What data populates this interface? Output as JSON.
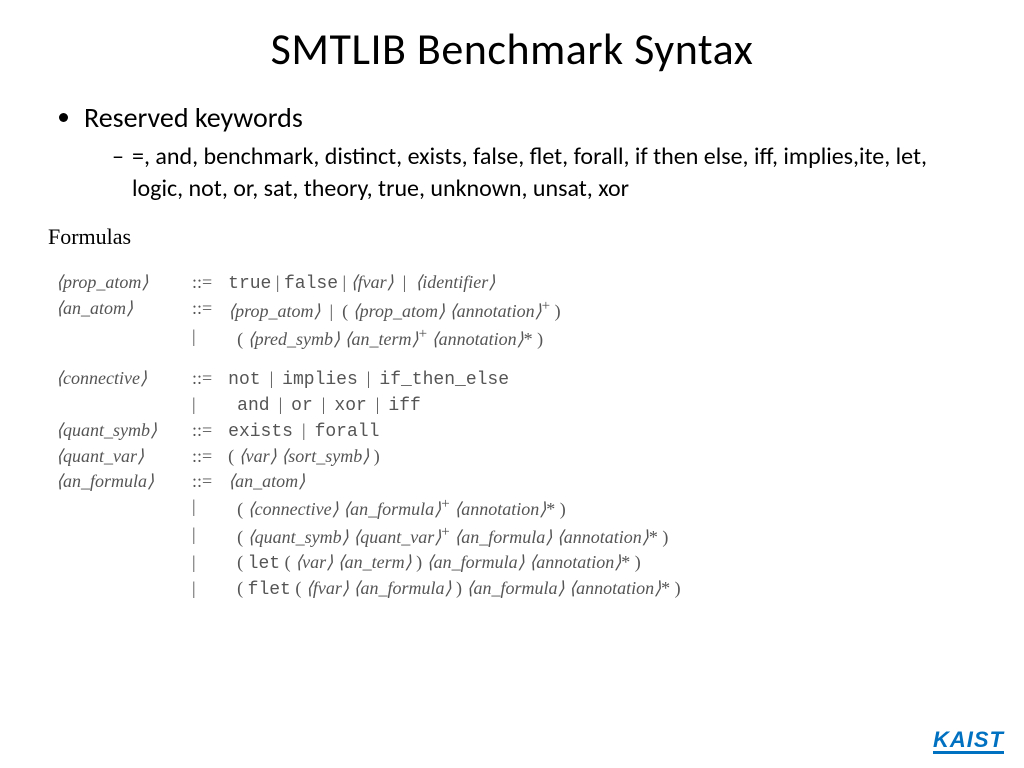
{
  "title": "SMTLIB Benchmark Syntax",
  "bullet1": "Reserved keywords",
  "bullet1_sub": "=, and, benchmark, distinct, exists, false, flet, forall, if then else, iff, implies,ite, let, logic, not, or, sat, theory, true, unknown, unsat, xor",
  "formulas_label": "Formulas",
  "grammar": {
    "prop_atom": {
      "lhs": "⟨prop_atom⟩",
      "rhs1": "true | false | ⟨fvar⟩ | ⟨identifier⟩"
    },
    "an_atom": {
      "lhs": "⟨an_atom⟩",
      "rhs1": "⟨prop_atom⟩ | ( ⟨prop_atom⟩ ⟨annotation⟩⁺ )",
      "rhs2": "( ⟨pred_symb⟩ ⟨an_term⟩⁺ ⟨annotation⟩* )"
    },
    "connective": {
      "lhs": "⟨connective⟩",
      "rhs1": "not | implies | if_then_else",
      "rhs2": "and | or | xor | iff"
    },
    "quant_symb": {
      "lhs": "⟨quant_symb⟩",
      "rhs1": "exists | forall"
    },
    "quant_var": {
      "lhs": "⟨quant_var⟩",
      "rhs1": "( ⟨var⟩ ⟨sort_symb⟩ )"
    },
    "an_formula": {
      "lhs": "⟨an_formula⟩",
      "rhs1": "⟨an_atom⟩",
      "rhs2": "( ⟨connective⟩ ⟨an_formula⟩⁺ ⟨annotation⟩* )",
      "rhs3": "( ⟨quant_symb⟩ ⟨quant_var⟩⁺ ⟨an_formula⟩ ⟨annotation⟩* )",
      "rhs4": "( let ( ⟨var⟩ ⟨an_term⟩ ) ⟨an_formula⟩ ⟨annotation⟩* )",
      "rhs5": "( flet ( ⟨fvar⟩ ⟨an_formula⟩ ) ⟨an_formula⟩ ⟨annotation⟩* )"
    }
  },
  "coloneq": "::=",
  "pipe": "|",
  "logo_text": "KAIST"
}
